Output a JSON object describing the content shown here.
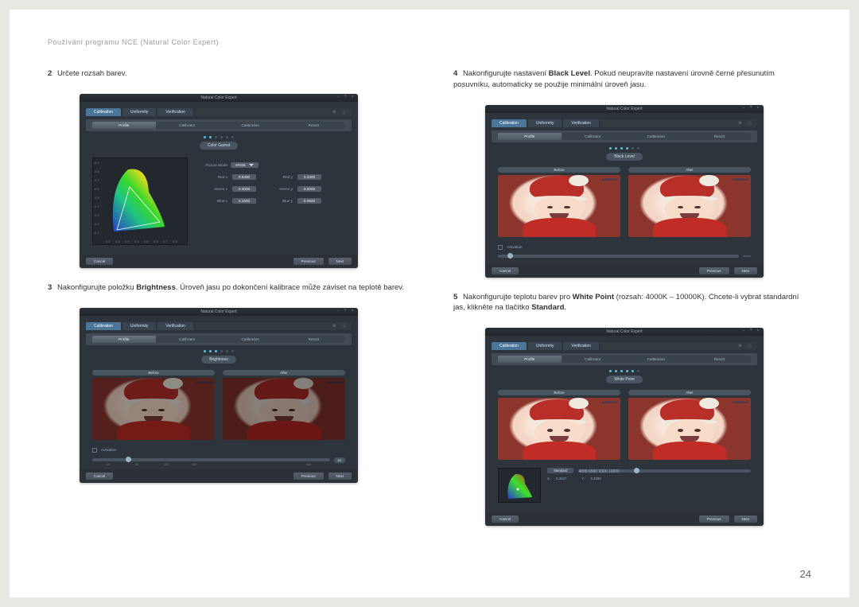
{
  "header": "Používání programu NCE (Natural Color Expert)",
  "page_number": "24",
  "colors": {
    "accent": "#4b7699"
  },
  "app_title": "Natural Color Expert",
  "tabs0": {
    "calibration": "Calibration",
    "uniformity": "Uniformity",
    "verification": "Verification"
  },
  "tabs1": {
    "profile": "Profile",
    "calibrator": "Calibrator",
    "calibration": "Calibration",
    "result": "Result"
  },
  "footer": {
    "cancel": "Cancel",
    "previous": "Previous",
    "next": "Next"
  },
  "before": "Before",
  "after": "After",
  "activation": "Activation",
  "samsung": "SAMSUNG",
  "steps": {
    "s2": {
      "num": "2",
      "text": "Určete rozsah barev."
    },
    "s3": {
      "num": "3",
      "pre": "Nakonfigurujte položku ",
      "bold": "Brightness",
      "post": ". Úroveň jasu po dokončení kalibrace může záviset na teplotě barev."
    },
    "s4": {
      "num": "4",
      "pre": "Nakonfigurujte nastavení ",
      "bold": "Black Level",
      "post": ". Pokud neupravíte nastavení úrovně černé přesunutím posuvníku, automaticky se použije minimální úroveň jasu."
    },
    "s5": {
      "num": "5",
      "pre": "Nakonfigurujte teplotu barev pro ",
      "bold": "White Point",
      "post1": " (rozsah: 4000K – 10000K). Chcete-li vybrat standardní jas, klikněte na tlačítko ",
      "bold2": "Standard",
      "post2": "."
    }
  },
  "panel_gamut": {
    "title": "Color Gamut",
    "picture_mode_label": "Picture Mode",
    "picture_mode_value": "sRGB",
    "red_label": "Red x",
    "red_x": "0.6400",
    "red_y_label": "Red y",
    "red_y": "0.3300",
    "green_label": "Green x",
    "green_x": "0.3000",
    "green_y_label": "Green y",
    "green_y": "0.6000",
    "blue_label": "Blue x",
    "blue_x": "0.1500",
    "blue_y_label": "Blue y",
    "blue_y": "0.0600",
    "y_ticks": [
      "0.9",
      "0.8",
      "0.7",
      "0.6",
      "0.5",
      "0.4",
      "0.3",
      "0.2",
      "0.1",
      "0"
    ],
    "x_ticks": [
      "0.1",
      "0.2",
      "0.3",
      "0.4",
      "0.5",
      "0.6",
      "0.7",
      "0.8"
    ]
  },
  "panel_brightness": {
    "title": "Brightness",
    "ticks": [
      "40",
      "80",
      "120",
      "160",
      "",
      "400"
    ],
    "value": "80"
  },
  "panel_black": {
    "title": "Black Level",
    "value": ""
  },
  "panel_wp": {
    "title": "White Point",
    "standard": "Standard",
    "x_label": "X :",
    "x_val": "0.3127",
    "y_label": "Y :",
    "y_val": "0.3290",
    "ticks": [
      "4000",
      "6500",
      "",
      "",
      "9300",
      "10000"
    ]
  }
}
